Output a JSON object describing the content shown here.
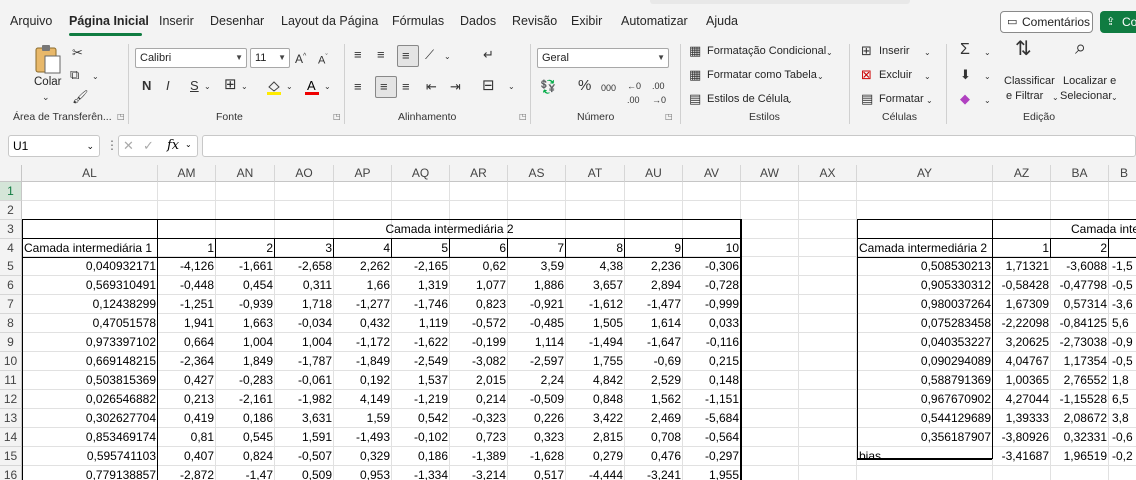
{
  "menu": {
    "items": [
      "Arquivo",
      "Página Inicial",
      "Inserir",
      "Desenhar",
      "Layout da Página",
      "Fórmulas",
      "Dados",
      "Revisão",
      "Exibir",
      "Automatizar",
      "Ajuda"
    ],
    "active": "Página Inicial",
    "comments": "Comentários",
    "share": "Co"
  },
  "ribbon": {
    "clipboard": {
      "paste": "Colar",
      "label": "Área de Transferên..."
    },
    "font": {
      "name": "Calibri",
      "size": "11",
      "label": "Fonte",
      "bold": "N",
      "italic": "I",
      "underline": "S"
    },
    "alignment": {
      "label": "Alinhamento"
    },
    "number": {
      "format": "Geral",
      "label": "Número"
    },
    "styles": {
      "conditional": "Formatação Condicional",
      "as_table": "Formatar como Tabela",
      "cell_styles": "Estilos de Célula",
      "label": "Estilos"
    },
    "cells": {
      "insert": "Inserir",
      "delete": "Excluir",
      "format": "Formatar",
      "label": "Células"
    },
    "editing": {
      "sort1": "Classificar",
      "sort2": "e Filtrar",
      "find1": "Localizar e",
      "find2": "Selecionar",
      "label": "Edição"
    },
    "accent": "#107c41"
  },
  "formula_bar": {
    "name_box": "U1",
    "fx": "fx",
    "formula": ""
  },
  "columns": [
    "AL",
    "AM",
    "AN",
    "AO",
    "AP",
    "AQ",
    "AR",
    "AS",
    "AT",
    "AU",
    "AV",
    "AW",
    "AX",
    "AY",
    "AZ",
    "BA",
    "B"
  ],
  "rows": [
    "1",
    "2",
    "3",
    "4",
    "5",
    "6",
    "7",
    "8",
    "9",
    "10",
    "11",
    "12",
    "13",
    "14",
    "15",
    "16"
  ],
  "table1": {
    "title": "Camada intermediária 2",
    "corner": "Camada intermediária 1",
    "headers": [
      "1",
      "2",
      "3",
      "4",
      "5",
      "6",
      "7",
      "8",
      "9",
      "10"
    ],
    "rows": [
      [
        "0,040932171",
        "-4,126",
        "-1,661",
        "-2,658",
        "2,262",
        "-2,165",
        "0,62",
        "3,59",
        "4,38",
        "2,236",
        "-0,306"
      ],
      [
        "0,569310491",
        "-0,448",
        "0,454",
        "0,311",
        "1,66",
        "1,319",
        "1,077",
        "1,886",
        "3,657",
        "2,894",
        "-0,728"
      ],
      [
        "0,12438299",
        "-1,251",
        "-0,939",
        "1,718",
        "-1,277",
        "-1,746",
        "0,823",
        "-0,921",
        "-1,612",
        "-1,477",
        "-0,999"
      ],
      [
        "0,47051578",
        "1,941",
        "1,663",
        "-0,034",
        "0,432",
        "1,119",
        "-0,572",
        "-0,485",
        "1,505",
        "1,614",
        "0,033"
      ],
      [
        "0,973397102",
        "0,664",
        "1,004",
        "1,004",
        "-1,172",
        "-1,622",
        "-0,199",
        "1,114",
        "-1,494",
        "-1,647",
        "-0,116"
      ],
      [
        "0,669148215",
        "-2,364",
        "1,849",
        "-1,787",
        "-1,849",
        "-2,549",
        "-3,082",
        "-2,597",
        "1,755",
        "-0,69",
        "0,215"
      ],
      [
        "0,503815369",
        "0,427",
        "-0,283",
        "-0,061",
        "0,192",
        "1,537",
        "2,015",
        "2,24",
        "4,842",
        "2,529",
        "0,148"
      ],
      [
        "0,026546882",
        "0,213",
        "-2,161",
        "-1,982",
        "4,149",
        "-1,219",
        "0,214",
        "-0,509",
        "0,848",
        "1,562",
        "-1,151"
      ],
      [
        "0,302627704",
        "0,419",
        "0,186",
        "3,631",
        "1,59",
        "0,542",
        "-0,323",
        "0,226",
        "3,422",
        "2,469",
        "-5,684"
      ],
      [
        "0,853469174",
        "0,81",
        "0,545",
        "1,591",
        "-1,493",
        "-0,102",
        "0,723",
        "0,323",
        "2,815",
        "0,708",
        "-0,564"
      ],
      [
        "0,595741103",
        "0,407",
        "0,824",
        "-0,507",
        "0,329",
        "0,186",
        "-1,389",
        "-1,628",
        "0,279",
        "0,476",
        "-0,297"
      ],
      [
        "0,779138857",
        "-2,872",
        "-1,47",
        "0,509",
        "0,953",
        "-1,334",
        "-3,214",
        "0,517",
        "-4,444",
        "-3,241",
        "1,955"
      ]
    ]
  },
  "table2": {
    "title": "Camada inte",
    "corner": "Camada intermediária 2",
    "headers": [
      "1",
      "2"
    ],
    "rows": [
      [
        "0,508530213",
        "1,71321",
        "-3,6088",
        "-1,5"
      ],
      [
        "0,905330312",
        "-0,58428",
        "-0,47798",
        "-0,5"
      ],
      [
        "0,980037264",
        "1,67309",
        "0,57314",
        "-3,6"
      ],
      [
        "0,075283458",
        "-2,22098",
        "-0,84125",
        "5,6"
      ],
      [
        "0,040353227",
        "3,20625",
        "-2,73038",
        "-0,9"
      ],
      [
        "0,090294089",
        "4,04767",
        "1,17354",
        "-0,5"
      ],
      [
        "0,588791369",
        "1,00365",
        "2,76552",
        "1,8"
      ],
      [
        "0,967670902",
        "4,27044",
        "-1,15528",
        "6,5"
      ],
      [
        "0,544129689",
        "1,39333",
        "2,08672",
        "3,8"
      ],
      [
        "0,356187907",
        "-3,80926",
        "0,32331",
        "-0,6"
      ],
      [
        "bias",
        "-3,41687",
        "1,96519",
        "-0,2"
      ]
    ]
  }
}
